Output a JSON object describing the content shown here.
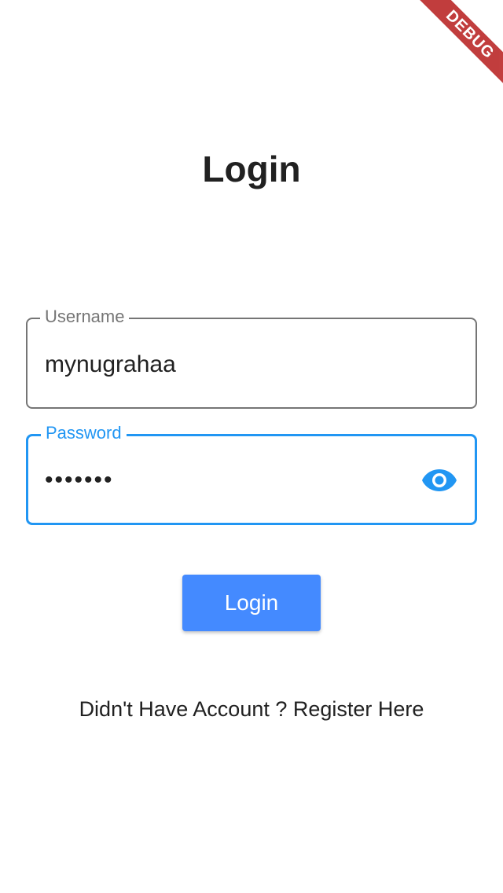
{
  "debug_banner": {
    "label": "DEBUG"
  },
  "page": {
    "title": "Login"
  },
  "form": {
    "username": {
      "label": "Username",
      "value": "mynugrahaa"
    },
    "password": {
      "label": "Password",
      "value": "•••••••",
      "toggle_icon": "eye-icon"
    },
    "submit_label": "Login",
    "register_link": "Didn't Have Account ? Register Here"
  },
  "colors": {
    "accent": "#2196f3",
    "button": "#448aff",
    "text": "#212121",
    "muted": "#757575",
    "debug": "#b71c1c"
  }
}
